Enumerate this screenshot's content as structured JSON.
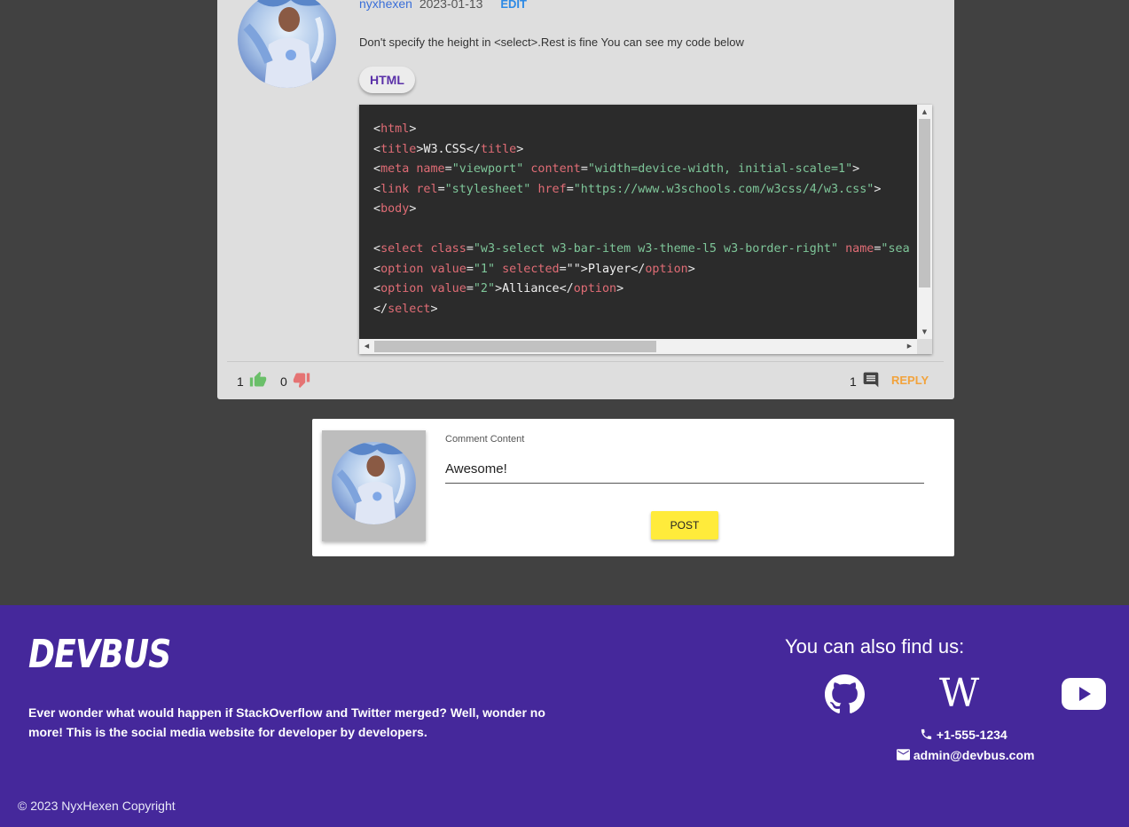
{
  "post": {
    "author": "nyxhexen",
    "date": "2023-01-13",
    "edit_label": "EDIT",
    "text": "Don't specify the height in <select>.Rest is fine You can see my code below",
    "tag": "HTML",
    "likes": "1",
    "dislikes": "0",
    "comments_count": "1",
    "reply_label": "REPLY"
  },
  "code": {
    "language": "HTML",
    "lines": [
      [
        [
          "p",
          "<"
        ],
        [
          "tag",
          "html"
        ],
        [
          "p",
          ">"
        ]
      ],
      [
        [
          "p",
          "<"
        ],
        [
          "tag",
          "title"
        ],
        [
          "p",
          ">"
        ],
        [
          "txt",
          "W3.CSS"
        ],
        [
          "p",
          "</"
        ],
        [
          "tag",
          "title"
        ],
        [
          "p",
          ">"
        ]
      ],
      [
        [
          "p",
          "<"
        ],
        [
          "tag",
          "meta"
        ],
        [
          "p",
          " "
        ],
        [
          "attr",
          "name"
        ],
        [
          "p",
          "="
        ],
        [
          "str",
          "\"viewport\""
        ],
        [
          "p",
          " "
        ],
        [
          "attr",
          "content"
        ],
        [
          "p",
          "="
        ],
        [
          "str",
          "\"width=device-width, initial-scale=1\""
        ],
        [
          "p",
          ">"
        ]
      ],
      [
        [
          "p",
          "<"
        ],
        [
          "tag",
          "link"
        ],
        [
          "p",
          " "
        ],
        [
          "attr",
          "rel"
        ],
        [
          "p",
          "="
        ],
        [
          "str",
          "\"stylesheet\""
        ],
        [
          "p",
          " "
        ],
        [
          "attr",
          "href"
        ],
        [
          "p",
          "="
        ],
        [
          "str",
          "\"https://www.w3schools.com/w3css/4/w3.css\""
        ],
        [
          "p",
          ">"
        ]
      ],
      [
        [
          "p",
          "<"
        ],
        [
          "tag",
          "body"
        ],
        [
          "p",
          ">"
        ]
      ],
      [
        [
          "p",
          " "
        ]
      ],
      [
        [
          "p",
          "<"
        ],
        [
          "tag",
          "select"
        ],
        [
          "p",
          " "
        ],
        [
          "attr",
          "class"
        ],
        [
          "p",
          "="
        ],
        [
          "str",
          "\"w3-select w3-bar-item w3-theme-l5 w3-border-right\""
        ],
        [
          "p",
          " "
        ],
        [
          "attr",
          "name"
        ],
        [
          "p",
          "="
        ],
        [
          "str",
          "\"sea"
        ]
      ],
      [
        [
          "p",
          "<"
        ],
        [
          "tag",
          "option"
        ],
        [
          "p",
          " "
        ],
        [
          "attr",
          "value"
        ],
        [
          "p",
          "="
        ],
        [
          "str",
          "\"1\""
        ],
        [
          "p",
          " "
        ],
        [
          "attr",
          "selected"
        ],
        [
          "p",
          "=\"\">"
        ],
        [
          "txt",
          "Player"
        ],
        [
          "p",
          "</"
        ],
        [
          "tag",
          "option"
        ],
        [
          "p",
          ">"
        ]
      ],
      [
        [
          "p",
          "<"
        ],
        [
          "tag",
          "option"
        ],
        [
          "p",
          " "
        ],
        [
          "attr",
          "value"
        ],
        [
          "p",
          "="
        ],
        [
          "str",
          "\"2\""
        ],
        [
          "p",
          ">"
        ],
        [
          "txt",
          "Alliance"
        ],
        [
          "p",
          "</"
        ],
        [
          "tag",
          "option"
        ],
        [
          "p",
          ">"
        ]
      ],
      [
        [
          "p",
          "</"
        ],
        [
          "tag",
          "select"
        ],
        [
          "p",
          ">"
        ]
      ]
    ]
  },
  "comment_form": {
    "label": "Comment Content",
    "value": "Awesome!",
    "submit_label": "POST"
  },
  "footer": {
    "brand": "DEVBUS",
    "tagline": "Ever wonder what would happen if StackOverflow and Twitter merged? Well, wonder no more! This is the social media website for developer by developers.",
    "find_us": "You can also find us:",
    "social": [
      "github-icon",
      "wikipedia-icon",
      "youtube-icon"
    ],
    "phone": "+1-555-1234",
    "email": "admin@devbus.com",
    "copyright": "© 2023 NyxHexen Copyright"
  },
  "colors": {
    "page_bg": "#414141",
    "card_bg": "#dedede",
    "footer_bg": "#45289b",
    "like": "#6abf69",
    "dislike": "#e57373",
    "reply": "#f2a33c",
    "post_button": "#ffeb3b"
  }
}
